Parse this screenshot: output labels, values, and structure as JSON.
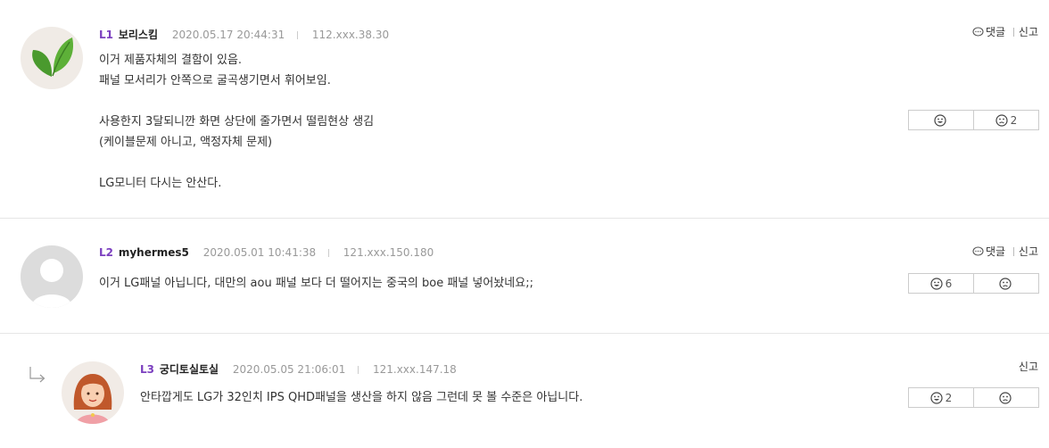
{
  "comments": [
    {
      "level": "L1",
      "nick": "보리스킴",
      "date": "2020.05.17 20:44:31",
      "ip": "112.xxx.38.30",
      "reply_label": "댓글",
      "report_label": "신고",
      "lines": [
        "이거 제품자체의 결함이 있음.",
        "패널 모서리가 안쪽으로 굴곡생기면서 휘어보임.",
        "",
        "사용한지 3달되니깐 화면 상단에 줄가면서 떨림현상 생김",
        "(케이블문제 아니고, 액정자체 문제)",
        "",
        "LG모니터 다시는 안산다."
      ],
      "like_count": "",
      "dislike_count": "2"
    },
    {
      "level": "L2",
      "nick": "myhermes5",
      "date": "2020.05.01 10:41:38",
      "ip": "121.xxx.150.180",
      "reply_label": "댓글",
      "report_label": "신고",
      "lines": [
        "이거 LG패널 아닙니다, 대만의 aou 패널 보다 더 떨어지는 중국의 boe 패널 넣어놨네요;;"
      ],
      "like_count": "6",
      "dislike_count": ""
    },
    {
      "level": "L3",
      "nick": "궁디토실토실",
      "date": "2020.05.05 21:06:01",
      "ip": "121.xxx.147.18",
      "report_label": "신고",
      "lines": [
        "안타깝게도 LG가 32인치 IPS QHD패널을 생산을 하지 않음 그런데 못 볼 수준은 아닙니다."
      ],
      "like_count": "2",
      "dislike_count": ""
    }
  ],
  "icons": {
    "reply": "speech-bubble-icon",
    "like": "smile-face-icon",
    "dislike": "frown-face-icon",
    "reply_arrow": "reply-arrow-icon"
  },
  "colors": {
    "level": "#7b3fbf",
    "meta": "#999999",
    "leaf": "#4a9a2e"
  }
}
